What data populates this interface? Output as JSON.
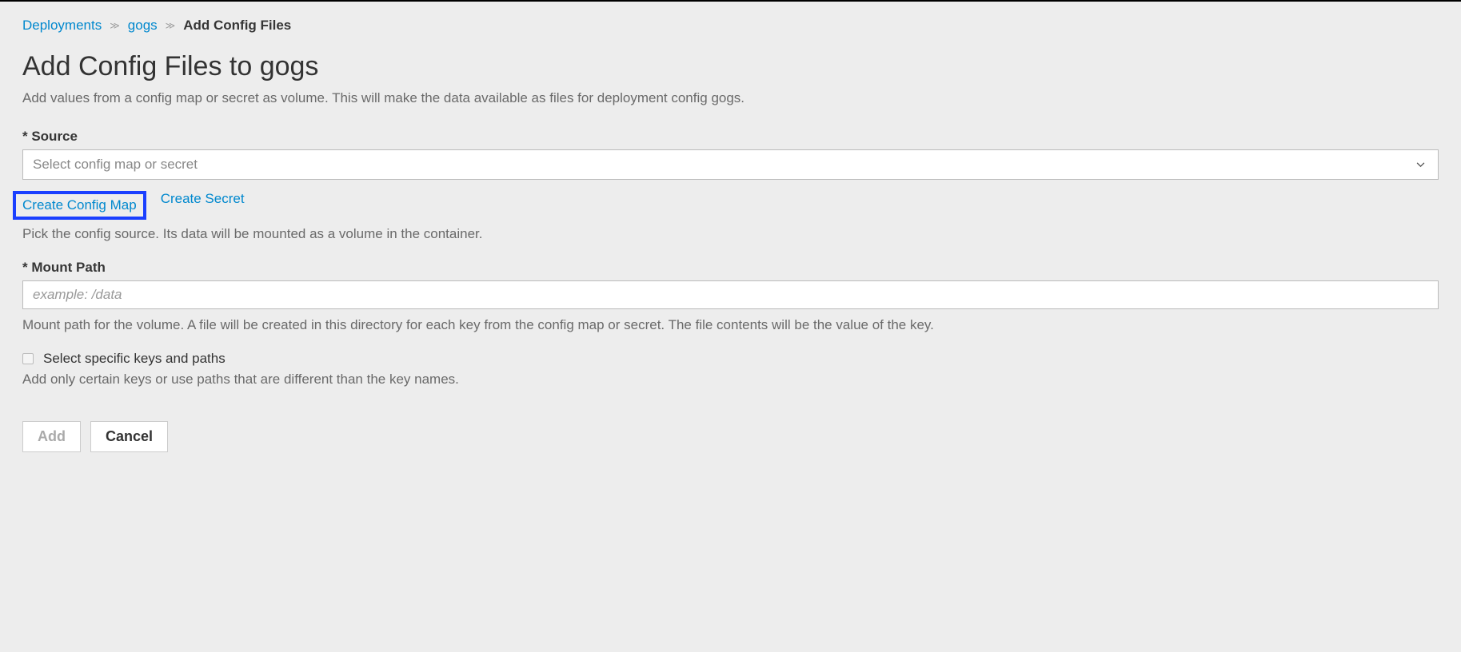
{
  "breadcrumb": {
    "deployments": "Deployments",
    "item": "gogs",
    "current": "Add Config Files"
  },
  "page": {
    "title": "Add Config Files to gogs",
    "description": "Add values from a config map or secret as volume. This will make the data available as files for deployment config gogs."
  },
  "source": {
    "label": "* Source",
    "placeholder": "Select config map or secret",
    "create_config_map": "Create Config Map",
    "create_secret": "Create Secret",
    "help": "Pick the config source. Its data will be mounted as a volume in the container."
  },
  "mount": {
    "label": "* Mount Path",
    "placeholder": "example: /data",
    "value": "",
    "help": "Mount path for the volume. A file will be created in this directory for each key from the config map or secret. The file contents will be the value of the key."
  },
  "keys": {
    "checkbox_label": "Select specific keys and paths",
    "help": "Add only certain keys or use paths that are different than the key names."
  },
  "buttons": {
    "add": "Add",
    "cancel": "Cancel"
  }
}
